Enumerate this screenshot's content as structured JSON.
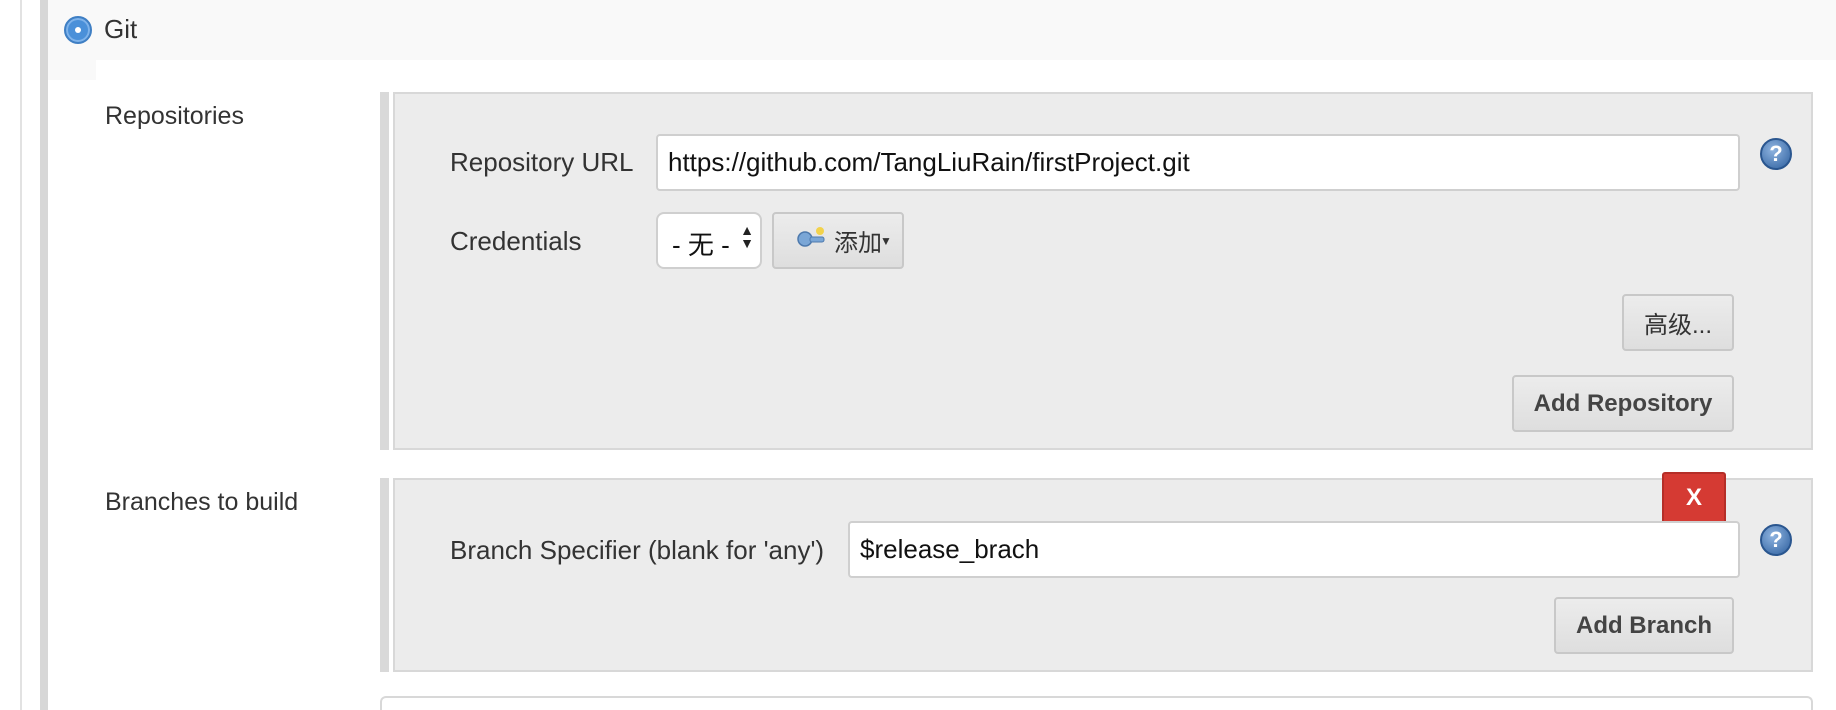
{
  "git": {
    "label": "Git"
  },
  "repositories": {
    "label": "Repositories",
    "url_label": "Repository URL",
    "url_value": "https://github.com/TangLiuRain/firstProject.git",
    "credentials_label": "Credentials",
    "credentials_selected": "- 无 -",
    "add_label": "添加",
    "advanced_label": "高级...",
    "add_repository_label": "Add Repository"
  },
  "branches": {
    "label": "Branches to build",
    "delete_label": "X",
    "specifier_label": "Branch Specifier (blank for 'any')",
    "specifier_value": "$release_brach",
    "add_branch_label": "Add Branch"
  },
  "help": {
    "glyph": "?"
  },
  "icons": {
    "radio": "radio-selected-icon",
    "help": "help-icon",
    "key": "key-icon",
    "dropdown": "dropdown-arrow-icon"
  },
  "colors": {
    "accent": "#4a90d9",
    "delete": "#d53a33",
    "panel": "#ececec"
  }
}
